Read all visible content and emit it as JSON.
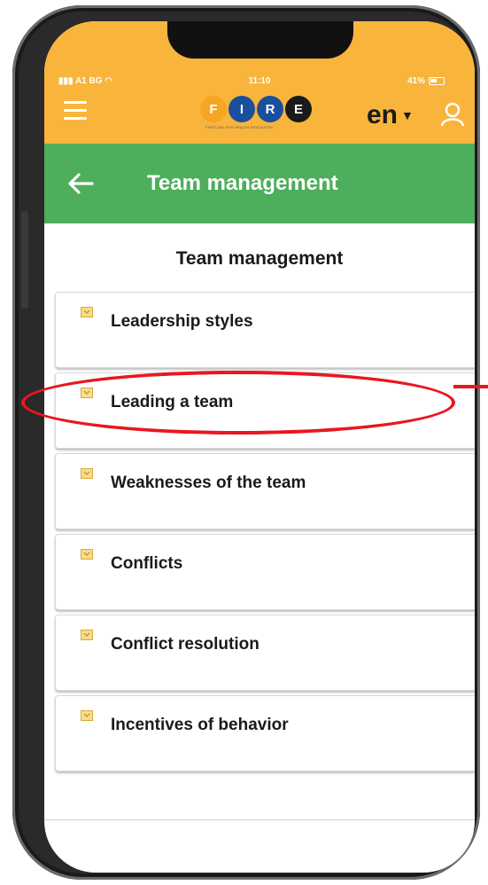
{
  "status_bar": {
    "carrier": "A1 BG",
    "time": "11:10",
    "battery": "41%"
  },
  "header": {
    "logo_letters": [
      "F",
      "I",
      "R",
      "E"
    ],
    "logo_colors": [
      "#f5a623",
      "#1a4f9c",
      "#1a4f9c",
      "#1a1a1a"
    ],
    "logo_tagline": "FIRST-AID FOR HEALTH EDUCATION",
    "language": "en",
    "accent": "#f9b43c"
  },
  "title_bar": {
    "title": "Team management",
    "color": "#4dae5c"
  },
  "content": {
    "section_title": "Team management",
    "topics": [
      {
        "label": "Leadership styles"
      },
      {
        "label": "Leading a team"
      },
      {
        "label": "Weaknesses of the team"
      },
      {
        "label": "Conflicts"
      },
      {
        "label": "Conflict resolution"
      },
      {
        "label": "Incentives of behavior"
      }
    ]
  },
  "annotation": {
    "highlighted_topic": "Leading a team",
    "color": "#e8171f"
  }
}
